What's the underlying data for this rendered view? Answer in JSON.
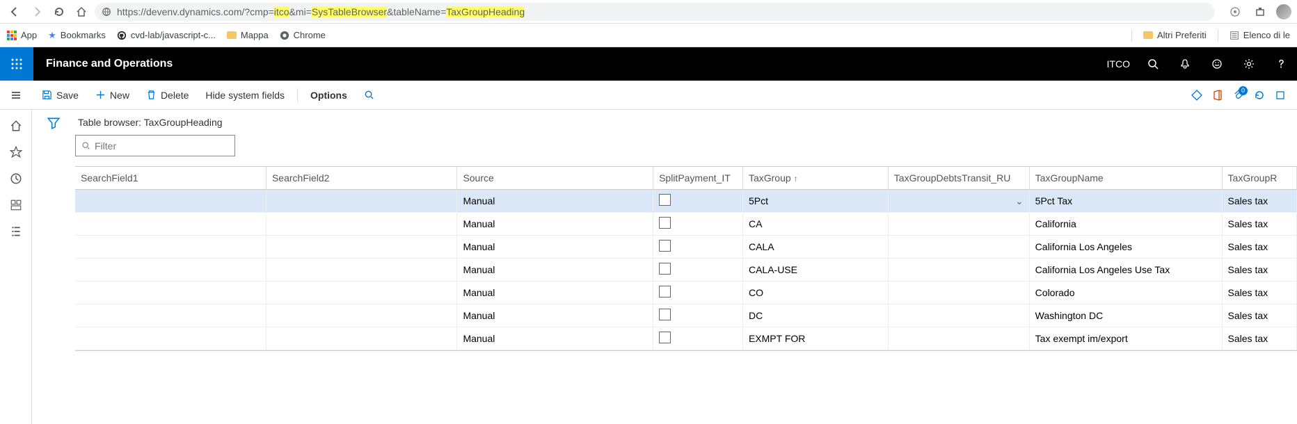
{
  "browser": {
    "url_parts": [
      "https://devenv.dynamics.com/?cmp=",
      "itco",
      "&mi=",
      "SysTableBrowser",
      "&tableName=",
      "TaxGroupHeading"
    ]
  },
  "bookmarks": {
    "app": "App",
    "bookmarks": "Bookmarks",
    "gh": "cvd-lab/javascript-c...",
    "mappa": "Mappa",
    "chrome": "Chrome",
    "altri": "Altri Preferiti",
    "elenco": "Elenco di le"
  },
  "header": {
    "title": "Finance and Operations",
    "company": "ITCO"
  },
  "actions": {
    "save": "Save",
    "new": "New",
    "delete": "Delete",
    "hide": "Hide system fields",
    "options": "Options",
    "badge": "0"
  },
  "page": {
    "title": "Table browser: TaxGroupHeading",
    "filter_placeholder": "Filter"
  },
  "columns": {
    "c0": "SearchField1",
    "c1": "SearchField2",
    "c2": "Source",
    "c3": "SplitPayment_IT",
    "c4": "TaxGroup",
    "c5": "TaxGroupDebtsTransit_RU",
    "c6": "TaxGroupName",
    "c7": "TaxGroupR"
  },
  "rows": [
    {
      "source": "Manual",
      "taxgroup": "5Pct",
      "name": "5Pct Tax",
      "r": "Sales tax"
    },
    {
      "source": "Manual",
      "taxgroup": "CA",
      "name": "California",
      "r": "Sales tax"
    },
    {
      "source": "Manual",
      "taxgroup": "CALA",
      "name": "California Los Angeles",
      "r": "Sales tax"
    },
    {
      "source": "Manual",
      "taxgroup": "CALA-USE",
      "name": "California  Los Angeles Use Tax",
      "r": "Sales tax"
    },
    {
      "source": "Manual",
      "taxgroup": "CO",
      "name": "Colorado",
      "r": "Sales tax"
    },
    {
      "source": "Manual",
      "taxgroup": "DC",
      "name": "Washington DC",
      "r": "Sales tax"
    },
    {
      "source": "Manual",
      "taxgroup": "EXMPT FOR",
      "name": "Tax exempt im/export",
      "r": "Sales tax"
    }
  ]
}
